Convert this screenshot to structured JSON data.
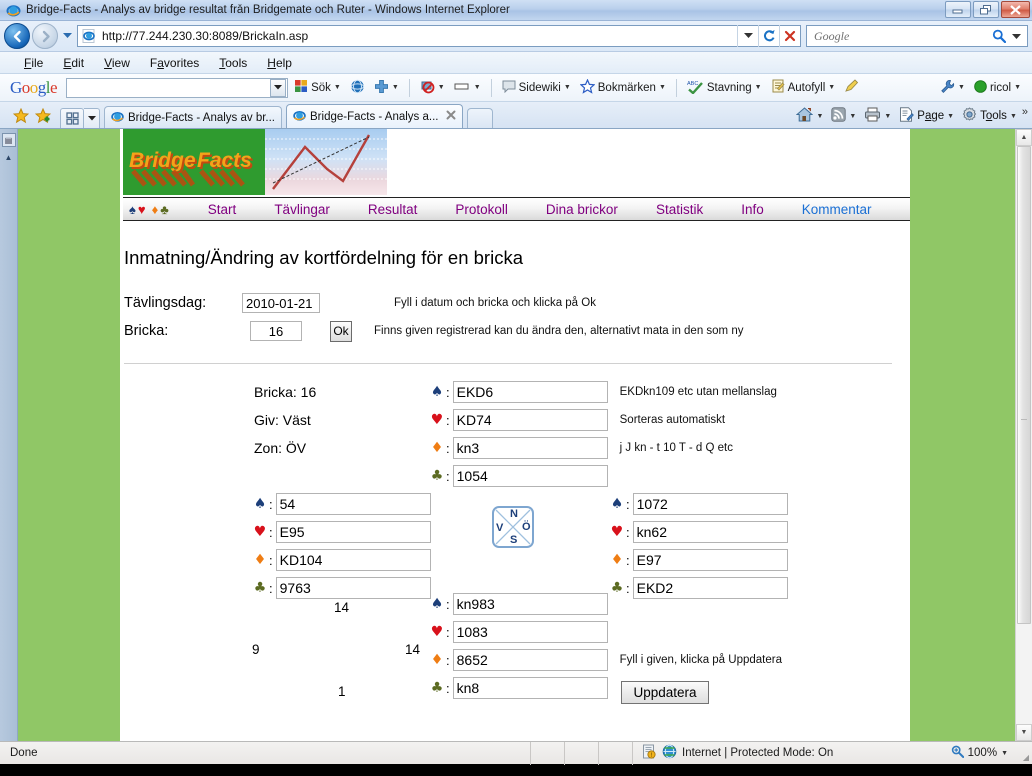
{
  "window": {
    "title": "Bridge-Facts - Analys av bridge resultat från Bridgemate och Ruter - Windows Internet Explorer",
    "minimize_label": "Minimize",
    "restore_label": "Restore",
    "close_label": "Close"
  },
  "address_bar": {
    "url": "http://77.244.230.30:8089/BrickaIn.asp",
    "back_label": "Back",
    "forward_label": "Forward",
    "refresh_label": "Refresh",
    "stop_label": "Stop",
    "history_label": "Recent Pages"
  },
  "search": {
    "placeholder": "Google",
    "button_label": "Search"
  },
  "menu": {
    "items": [
      {
        "label": "File",
        "accel": "F"
      },
      {
        "label": "Edit",
        "accel": "E"
      },
      {
        "label": "View",
        "accel": "V"
      },
      {
        "label": "Favorites",
        "accel": "a"
      },
      {
        "label": "Tools",
        "accel": "T"
      },
      {
        "label": "Help",
        "accel": "H"
      }
    ]
  },
  "google_toolbar": {
    "logo": "Google",
    "input_value": "",
    "buttons": [
      {
        "label": "Sök",
        "icon": "google-g-icon"
      },
      {
        "label": "",
        "icon": "globe-icon"
      },
      {
        "label": "",
        "icon": "plus-icon"
      },
      {
        "label": "",
        "icon": "popup-blocker-icon"
      },
      {
        "label": "",
        "icon": "highlight-icon"
      },
      {
        "label": "Sidewiki",
        "icon": "sidewiki-icon"
      },
      {
        "label": "Bokmärken",
        "icon": "star-icon"
      },
      {
        "label": "Stavning",
        "icon": "spellcheck-icon"
      },
      {
        "label": "Autofyll",
        "icon": "autofill-icon"
      },
      {
        "label": "",
        "icon": "pencil-icon"
      },
      {
        "label": "",
        "icon": "wrench-icon"
      },
      {
        "label": "ricol",
        "icon": "green-circle-icon"
      }
    ]
  },
  "tabs": {
    "favorites_label": "Favorites",
    "add_favorites_label": "Add to Favorites",
    "quicktabs_label": "Quick Tabs",
    "items": [
      {
        "label": "Bridge-Facts - Analys av br...",
        "active": false
      },
      {
        "label": "Bridge-Facts - Analys a...",
        "active": true
      }
    ],
    "new_tab_label": "New Tab"
  },
  "command_bar": {
    "items": [
      {
        "label": "",
        "icon": "home-icon"
      },
      {
        "label": "",
        "icon": "rss-icon"
      },
      {
        "label": "",
        "icon": "print-icon"
      },
      {
        "label": "Page",
        "icon": "page-icon",
        "accel": "P"
      },
      {
        "label": "Tools",
        "icon": "gear-icon",
        "accel": "o"
      }
    ],
    "overflow_label": "»"
  },
  "site": {
    "logo_text": "Bridge Facts",
    "nav": [
      {
        "label": "Start",
        "visited": true
      },
      {
        "label": "Tävlingar",
        "visited": true
      },
      {
        "label": "Resultat",
        "visited": true
      },
      {
        "label": "Protokoll",
        "visited": true
      },
      {
        "label": "Dina brickor",
        "visited": true
      },
      {
        "label": "Statistik",
        "visited": true
      },
      {
        "label": "Info",
        "visited": true
      },
      {
        "label": "Kommentar",
        "visited": false
      }
    ],
    "suits_decor": [
      "♠",
      "♥",
      "♦",
      "♣"
    ]
  },
  "page": {
    "title": "Inmatning/Ändring av kortfördelning för en bricka",
    "form": {
      "date_label": "Tävlingsdag:",
      "date_value": "2010-01-21",
      "board_label": "Bricka:",
      "board_value": "16",
      "ok_label": "Ok",
      "hint_date": "Fyll i datum och bricka och klicka på Ok",
      "hint_board": "Finns given registrerad kan du ändra den, alternativt mata in den som ny"
    },
    "deal_info": {
      "board": "Bricka: 16",
      "dealer": "Giv: Väst",
      "vulnerability": "Zon: ÖV"
    },
    "hints": {
      "spades": "EKDkn109 etc utan mellanslag",
      "hearts": "Sorteras automatiskt",
      "diamonds": "j J kn - t 10 T - d Q etc",
      "update": "Fyll i given, klicka på Uppdatera"
    },
    "compass": {
      "north": "N",
      "west": "V",
      "east": "Ö",
      "south": "S"
    },
    "hcp": {
      "north": "14",
      "west": "9",
      "east": "14",
      "south": "1"
    },
    "hands": {
      "north": {
        "spades": "EKD6",
        "hearts": "KD74",
        "diamonds": "kn3",
        "clubs": "1054"
      },
      "west": {
        "spades": "54",
        "hearts": "E95",
        "diamonds": "KD104",
        "clubs": "9763"
      },
      "east": {
        "spades": "1072",
        "hearts": "kn62",
        "diamonds": "E97",
        "clubs": "EKD2"
      },
      "south": {
        "spades": "kn983",
        "hearts": "1083",
        "diamonds": "8652",
        "clubs": "kn8"
      }
    },
    "update_label": "Uppdatera",
    "suit_symbols": {
      "spade": "♠",
      "heart": "♥",
      "diamond": "♦",
      "club": "♣"
    }
  },
  "status_bar": {
    "status": "Done",
    "zone": "Internet | Protected Mode: On",
    "zoom": "100%"
  },
  "colors": {
    "page_background": "#90c766",
    "logo_green": "#2f9b2f",
    "link_visited": "#800080",
    "link_unvisited": "#1a6fd4",
    "spade": "#1d3f7a",
    "heart": "#d8111b",
    "diamond": "#ef7d14",
    "club": "#5c6b22"
  }
}
